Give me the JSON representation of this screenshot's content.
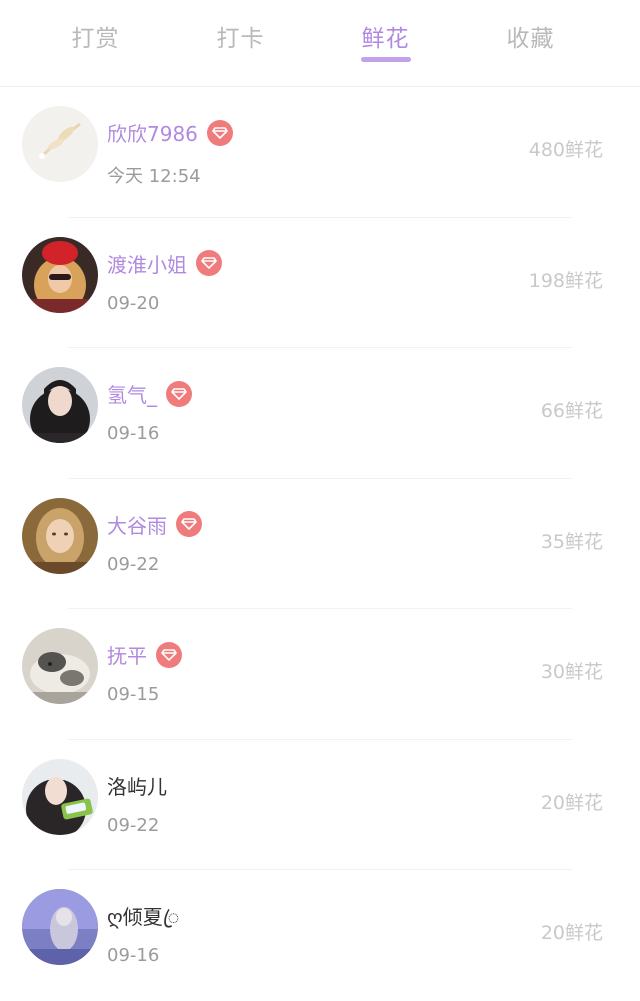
{
  "tabs": [
    {
      "label": "打赏",
      "active": false
    },
    {
      "label": "打卡",
      "active": false
    },
    {
      "label": "鲜花",
      "active": true
    },
    {
      "label": "收藏",
      "active": false
    }
  ],
  "list": [
    {
      "name": "欣欣7986",
      "vip": true,
      "date": "今天 12:54",
      "amount": "480鲜花"
    },
    {
      "name": "渡淮小姐",
      "vip": true,
      "date": "09-20",
      "amount": "198鲜花"
    },
    {
      "name": "氢气_",
      "vip": true,
      "date": "09-16",
      "amount": "66鲜花"
    },
    {
      "name": "大谷雨",
      "vip": true,
      "date": "09-22",
      "amount": "35鲜花"
    },
    {
      "name": "抚平",
      "vip": true,
      "date": "09-15",
      "amount": "30鲜花"
    },
    {
      "name": "洛屿儿",
      "vip": false,
      "date": "09-22",
      "amount": "20鲜花"
    },
    {
      "name": "ღ倾夏ꦿ",
      "vip": false,
      "date": "09-16",
      "amount": "20鲜花"
    }
  ],
  "icons": {
    "vip_badge": "diamond-icon"
  },
  "colors": {
    "accent": "#b18ae0",
    "tab_inactive": "#b9b9b9",
    "vip_badge": "#ef7b7c",
    "amount": "#c9c9c9",
    "date": "#9b9b9b"
  }
}
